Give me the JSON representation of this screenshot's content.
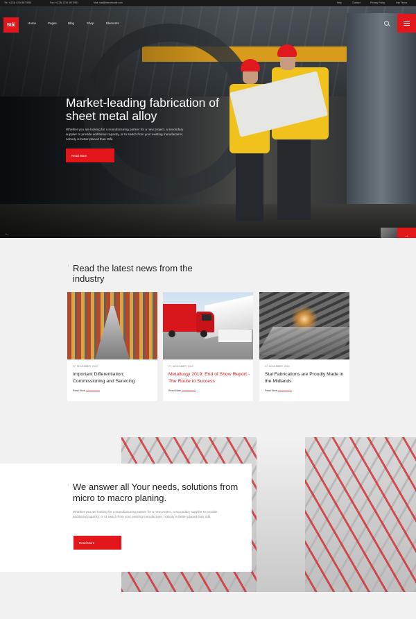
{
  "topbar": {
    "phone": "Tel: +(123) 1234 567 8901",
    "fax": "Fax: +(123) 1234 567 8901",
    "email": "Mail: stal@themefuselt.com",
    "links": [
      "Help",
      "Contact",
      "Privacy Policy",
      "Use Terms"
    ]
  },
  "header": {
    "logo": "Stål",
    "nav": [
      "Home",
      "Pages",
      "Blog",
      "Shop",
      "Elements"
    ]
  },
  "hero": {
    "title": "Market-leading fabrication of sheet metal alloy",
    "text": "Whether you are looking for a manufacturing partner for a new project, a secondary supplier to provide additional capacity, or to switch from your existing manufacturer, nobody is better placed than Stål.",
    "button": "Read More",
    "prev": "←",
    "next": "→"
  },
  "news": {
    "title": "Read the latest news from the industry",
    "cards": [
      {
        "date": "27, NOVEMBER, 2019",
        "title": "Important Differentiation: Commissioning and Servicing",
        "more": "Read More",
        "highlight": false
      },
      {
        "date": "27, NOVEMBER, 2019",
        "title": "Metallurgy 2019: End of Show Report - The Route to Success",
        "more": "Read More",
        "highlight": true
      },
      {
        "date": "27, NOVEMBER, 2019",
        "title": "Stal Fabrications are Proudly Made in the Midlands",
        "more": "Read More",
        "highlight": false
      }
    ]
  },
  "answer": {
    "title": "We answer all Your needs, solutions from micro to macro planing.",
    "text": "Whether you are looking for a manufacturing partner for a new project, a secondary supplier to provide additional capacity, or to switch from your existing manufacturer, nobody is better placed than Stål.",
    "button": "Read More"
  },
  "colors": {
    "accent": "#e3161b",
    "dark": "#1a1a1a",
    "background": "#f1f1f1"
  }
}
